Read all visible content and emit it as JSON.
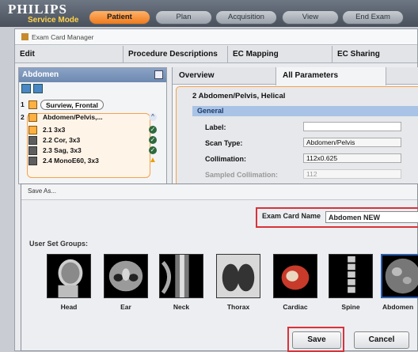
{
  "brand": {
    "logo": "PHILIPS",
    "mode": "Service Mode"
  },
  "topnav": [
    "Patient",
    "Plan",
    "Acquisition",
    "View",
    "End Exam"
  ],
  "window": {
    "title": "Exam Card Manager"
  },
  "menu": [
    "Edit",
    "Procedure Descriptions",
    "EC Mapping",
    "EC Sharing"
  ],
  "left": {
    "header": "Abdomen",
    "rows": [
      {
        "num": "1",
        "label": "Surview, Frontal"
      },
      {
        "num": "2",
        "label": "Abdomen/Pelvis,..."
      },
      {
        "label": "2.1 3x3"
      },
      {
        "label": "2.2 Cor, 3x3"
      },
      {
        "label": "2.3 Sag, 3x3"
      },
      {
        "label": "2.4 MonoE60, 3x3"
      }
    ]
  },
  "right": {
    "tabs": [
      "Overview",
      "All Parameters"
    ],
    "title": "2  Abdomen/Pelvis, Helical",
    "section": "General",
    "fields": [
      {
        "label": "Label:",
        "value": ""
      },
      {
        "label": "Scan Type:",
        "value": "Abdomen/Pelvis"
      },
      {
        "label": "Collimation:",
        "value": "112x0.625"
      },
      {
        "label": "Sampled Collimation:",
        "value": "112"
      }
    ]
  },
  "dialog": {
    "title": "Save As...",
    "ecn_label": "Exam Card Name",
    "ecn_value": "Abdomen NEW",
    "groups_label": "User Set Groups:",
    "groups": [
      "Head",
      "Ear",
      "Neck",
      "Thorax",
      "Cardiac",
      "Spine",
      "Abdomen"
    ],
    "save": "Save",
    "cancel": "Cancel"
  }
}
